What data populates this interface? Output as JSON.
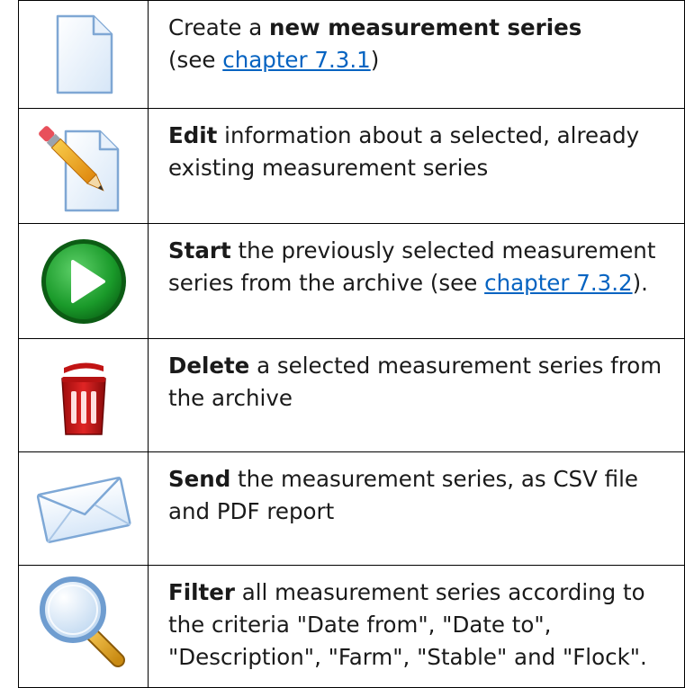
{
  "rows": [
    {
      "icon": "new-document-icon",
      "parts": [
        {
          "text": "Create a ",
          "bold": false
        },
        {
          "text": "new measurement series",
          "bold": true
        },
        {
          "br": true
        },
        {
          "text": "(see ",
          "bold": false
        },
        {
          "text": "chapter 7.3.1",
          "link": true
        },
        {
          "text": ")",
          "bold": false
        }
      ]
    },
    {
      "icon": "edit-document-icon",
      "parts": [
        {
          "text": "Edit",
          "bold": true
        },
        {
          "text": " information about a selected, already existing measurement series",
          "bold": false
        }
      ]
    },
    {
      "icon": "play-icon",
      "parts": [
        {
          "text": "Start",
          "bold": true
        },
        {
          "text": " the previously selected measurement series from the archive (see ",
          "bold": false
        },
        {
          "text": "chapter 7.3.2",
          "link": true
        },
        {
          "text": ").",
          "bold": false
        }
      ]
    },
    {
      "icon": "trash-icon",
      "parts": [
        {
          "text": "Delete",
          "bold": true
        },
        {
          "text": " a selected measurement series from the archive",
          "bold": false
        }
      ]
    },
    {
      "icon": "envelope-icon",
      "parts": [
        {
          "text": "Send",
          "bold": true
        },
        {
          "text": " the measurement series, as CSV file and PDF report",
          "bold": false
        }
      ]
    },
    {
      "icon": "magnifier-icon",
      "parts": [
        {
          "text": "Filter",
          "bold": true
        },
        {
          "text": " all measurement series according to the criteria \"Date from\", \"Date to\", \"Description\", \"Farm\", \"Stable\" and \"Flock\".",
          "bold": false
        }
      ]
    }
  ]
}
